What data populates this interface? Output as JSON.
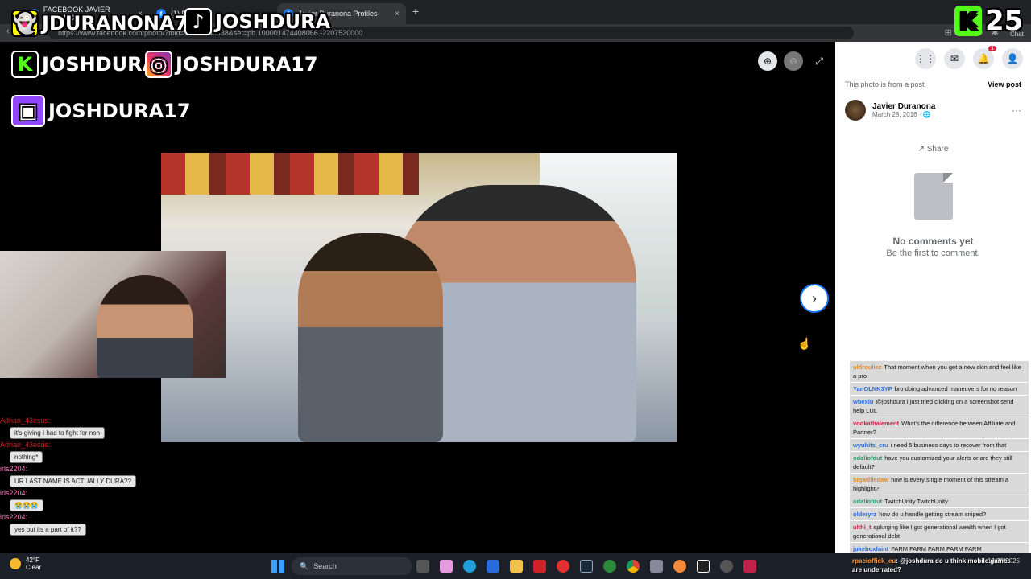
{
  "browser": {
    "tabs": [
      {
        "label": "FACEBOOK JAVIER DURANONA"
      },
      {
        "label": "(1) Fa"
      },
      {
        "label": "Javier Duranona Profiles"
      }
    ],
    "new_tab_label": "+",
    "url": "https://www.facebook.com/photo/?fbid=10505346938&set=pb.100001474408066.-2207520000"
  },
  "overlays": {
    "snap_handle": "JDURANONA76",
    "tiktok_handle": "JOSHDURA",
    "kick_handle": "JOSHDURA",
    "instagram_handle": "JOSHDURA17",
    "twitch_handle": "JOSHDURA17",
    "corner_number": "25",
    "corner_label": "Chat"
  },
  "left_chat": [
    {
      "user": "Adrian_43esus:",
      "msg": "it's giving I had to fight for non",
      "color": "red"
    },
    {
      "user": "Adrian_43esus:",
      "msg": "nothing*",
      "color": "red"
    },
    {
      "user": "irls2204:",
      "msg": "UR LAST NAME IS ACTUALLY DURA??",
      "color": "pink"
    },
    {
      "user": "irls2204:",
      "msg": "😭😭😭",
      "color": "pink"
    },
    {
      "user": "irls2204:",
      "msg": "yes but its a part of it??",
      "color": "pink"
    }
  ],
  "facebook": {
    "notification_count": "1",
    "from_post_text": "This photo is from a post.",
    "view_post": "View post",
    "author": "Javier Duranona",
    "date": "March 28, 2016 · 🌐",
    "more": "···",
    "share": "Share",
    "no_comments": "No comments yet",
    "first_comment": "Be the first to comment."
  },
  "right_chat": [
    {
      "user": "uldrouliez",
      "msg": "That moment when you get a new skin and feel like a pro",
      "color": "#d9892a"
    },
    {
      "user": "YanOLNK3YP",
      "msg": "bro doing advanced maneuvers for no reason",
      "color": "#2a6ad9"
    },
    {
      "user": "wbexiu",
      "msg": "@joshdura i just tried clicking on a screenshot send help LUL",
      "color": "#2a6ad9"
    },
    {
      "user": "vodkathalement",
      "msg": "What's the difference between Affiliate and Partner?",
      "color": "#c0284a"
    },
    {
      "user": "wyuhits_cru",
      "msg": "i need 5 business days to recover from that",
      "color": "#2a6ad9"
    },
    {
      "user": "odaliofdut",
      "msg": "have you customized your alerts or are they still default?",
      "color": "#2a9a6a"
    },
    {
      "user": "bigwilliedaw",
      "msg": "how is every single moment of this stream a highlight?",
      "color": "#d9892a"
    },
    {
      "user": "odaliofdut",
      "msg": "TwitchUnity TwitchUnity",
      "color": "#2a9a6a"
    },
    {
      "user": "olderyrz",
      "msg": "how do u handle getting stream sniped?",
      "color": "#2a6ad9"
    },
    {
      "user": "ulthi_t",
      "msg": "splurging like I got generational wealth when I got generational debt",
      "color": "#c0284a"
    },
    {
      "user": "jukeboxfaint",
      "msg": "FARM FARM FARM FARM FARM",
      "color": "#2a6ad9"
    }
  ],
  "taskbar": {
    "temperature": "42°F",
    "condition": "Clear",
    "search": "Search",
    "date": "12/30/2025",
    "chat_user": "rpacioffick_eu",
    "chat_msg": ": @joshdura do u think mobile games are underrated?"
  }
}
